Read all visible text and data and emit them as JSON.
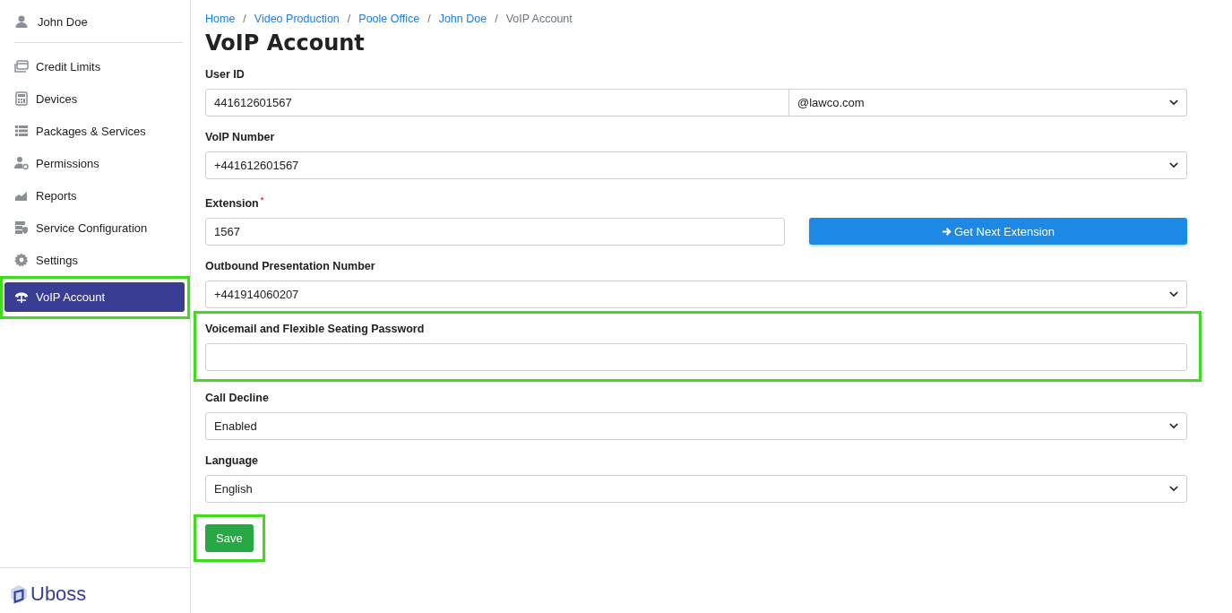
{
  "sidebar": {
    "user": "John Doe",
    "items": [
      {
        "label": "Credit Limits",
        "selected": false,
        "highlighted": false
      },
      {
        "label": "Devices",
        "selected": false,
        "highlighted": false
      },
      {
        "label": "Packages & Services",
        "selected": false,
        "highlighted": false
      },
      {
        "label": "Permissions",
        "selected": false,
        "highlighted": false
      },
      {
        "label": "Reports",
        "selected": false,
        "highlighted": false
      },
      {
        "label": "Service Configuration",
        "selected": false,
        "highlighted": false
      },
      {
        "label": "Settings",
        "selected": false,
        "highlighted": false
      },
      {
        "label": "VoIP Account",
        "selected": true,
        "highlighted": true
      }
    ],
    "logo": "Uboss"
  },
  "breadcrumb_separator": "/",
  "breadcrumb": [
    {
      "label": "Home",
      "current": false
    },
    {
      "label": "Video Production",
      "current": false
    },
    {
      "label": "Poole Office",
      "current": false
    },
    {
      "label": "John Doe",
      "current": false
    },
    {
      "label": "VoIP Account",
      "current": true
    }
  ],
  "title": "VoIP Account",
  "fields": [
    {
      "kind": "input_select",
      "label": "User ID",
      "highlighted": false,
      "value": "441612601567",
      "select_value": "@lawco.com"
    },
    {
      "kind": "select",
      "label": "VoIP Number",
      "highlighted": false,
      "value": "+441612601567"
    },
    {
      "kind": "input_button",
      "label": "Extension",
      "required_mark": "*",
      "highlighted": false,
      "value": "1567",
      "button": "Get Next Extension"
    },
    {
      "kind": "select",
      "label": "Outbound Presentation Number",
      "highlighted": false,
      "value": "+441914060207"
    },
    {
      "kind": "input",
      "label": "Voicemail and Flexible Seating Password",
      "highlighted": true
    },
    {
      "kind": "select",
      "label": "Call Decline",
      "highlighted": false,
      "value": "Enabled"
    },
    {
      "kind": "select",
      "label": "Language",
      "highlighted": false,
      "value": "English"
    }
  ],
  "save": {
    "label": "Save",
    "highlighted": true
  }
}
